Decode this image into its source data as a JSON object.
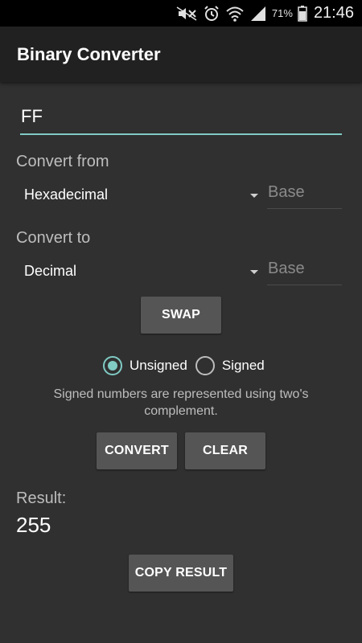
{
  "status_bar": {
    "icons": [
      "mute-icon",
      "alarm-icon",
      "wifi-icon",
      "signal-icon",
      "battery-icon"
    ],
    "battery_percent": "71%",
    "time": "21:46"
  },
  "app_bar": {
    "title": "Binary Converter"
  },
  "input": {
    "value": "FF"
  },
  "convert_from": {
    "label": "Convert from",
    "selected": "Hexadecimal",
    "base_placeholder": "Base"
  },
  "convert_to": {
    "label": "Convert to",
    "selected": "Decimal",
    "base_placeholder": "Base"
  },
  "buttons": {
    "swap": "SWAP",
    "convert": "CONVERT",
    "clear": "CLEAR",
    "copy_result": "COPY RESULT"
  },
  "sign_mode": {
    "options": [
      {
        "label": "Unsigned",
        "checked": true
      },
      {
        "label": "Signed",
        "checked": false
      }
    ],
    "hint": "Signed numbers are represented using two's complement."
  },
  "result": {
    "label": "Result:",
    "value": "255"
  },
  "colors": {
    "accent": "#80cbc4",
    "background": "#303030",
    "app_bar": "#212121",
    "button": "#555555"
  }
}
